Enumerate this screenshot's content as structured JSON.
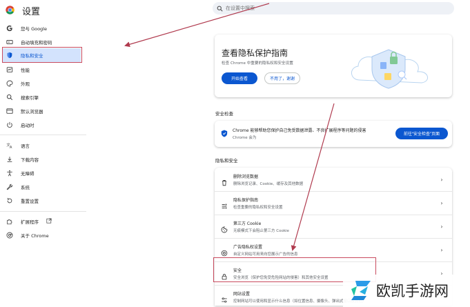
{
  "header": {
    "title": "设置",
    "search_placeholder": "在设置中搜索"
  },
  "sidebar": {
    "items": [
      {
        "label": "您与 Google",
        "icon": "google-icon"
      },
      {
        "label": "自动填充和密码",
        "icon": "autofill-icon"
      },
      {
        "label": "隐私和安全",
        "icon": "shield-icon",
        "active": true
      },
      {
        "label": "性能",
        "icon": "performance-icon"
      },
      {
        "label": "外观",
        "icon": "palette-icon"
      },
      {
        "label": "搜索引擎",
        "icon": "search-icon"
      },
      {
        "label": "默认浏览器",
        "icon": "browser-icon"
      },
      {
        "label": "启动时",
        "icon": "power-icon"
      },
      {
        "label": "语言",
        "icon": "translate-icon"
      },
      {
        "label": "下载内容",
        "icon": "download-icon"
      },
      {
        "label": "无障碍",
        "icon": "accessibility-icon"
      },
      {
        "label": "系统",
        "icon": "wrench-icon"
      },
      {
        "label": "重置设置",
        "icon": "reset-icon"
      },
      {
        "label": "扩展程序",
        "icon": "extension-icon"
      },
      {
        "label": "关于 Chrome",
        "icon": "chrome-icon"
      }
    ]
  },
  "privacy_guide": {
    "title": "查看隐私保护指南",
    "description": "检查 Chrome 中重要的隐私权和安全设置",
    "start_label": "开始查看",
    "no_thanks_label": "不用了，谢谢"
  },
  "safety_check": {
    "section_title": "安全检查",
    "line1": "Chrome 能够帮助您保护自己免受数据泄露、不良扩展程序等问题的侵害",
    "line2": "Chrome 会为",
    "button_label": "前往“安全检查”页面"
  },
  "privacy_section": {
    "section_title": "隐私和安全",
    "rows": [
      {
        "title": "删除浏览数据",
        "desc": "删除浏览记录、Cookie、缓存及其他数据",
        "icon": "trash-icon"
      },
      {
        "title": "隐私保护指南",
        "desc": "检查重要的隐私权和安全设置",
        "icon": "privacy-guide-icon"
      },
      {
        "title": "第三方 Cookie",
        "desc": "无痕模式下会阻止第三方 Cookie",
        "icon": "cookie-icon"
      },
      {
        "title": "广告隐私权设置",
        "desc": "自定义网站可用来向您展示广告的信息",
        "icon": "ad-privacy-icon"
      },
      {
        "title": "安全",
        "desc": "安全浏览（保护您免受危险网站的侵害）和其他安全设置",
        "icon": "lock-icon"
      },
      {
        "title": "网站设置",
        "desc": "控制网站可以使用和显示什么信息（如位置信息、摄像头、弹出式窗口及其他）",
        "icon": "site-settings-icon"
      }
    ]
  },
  "watermark": {
    "text": "欧凯手游网"
  },
  "colors": {
    "accent": "#0b57d0",
    "active_bg": "#d3e3fd",
    "highlight_box": "#c84a5e",
    "arrow": "#b03a4e"
  }
}
